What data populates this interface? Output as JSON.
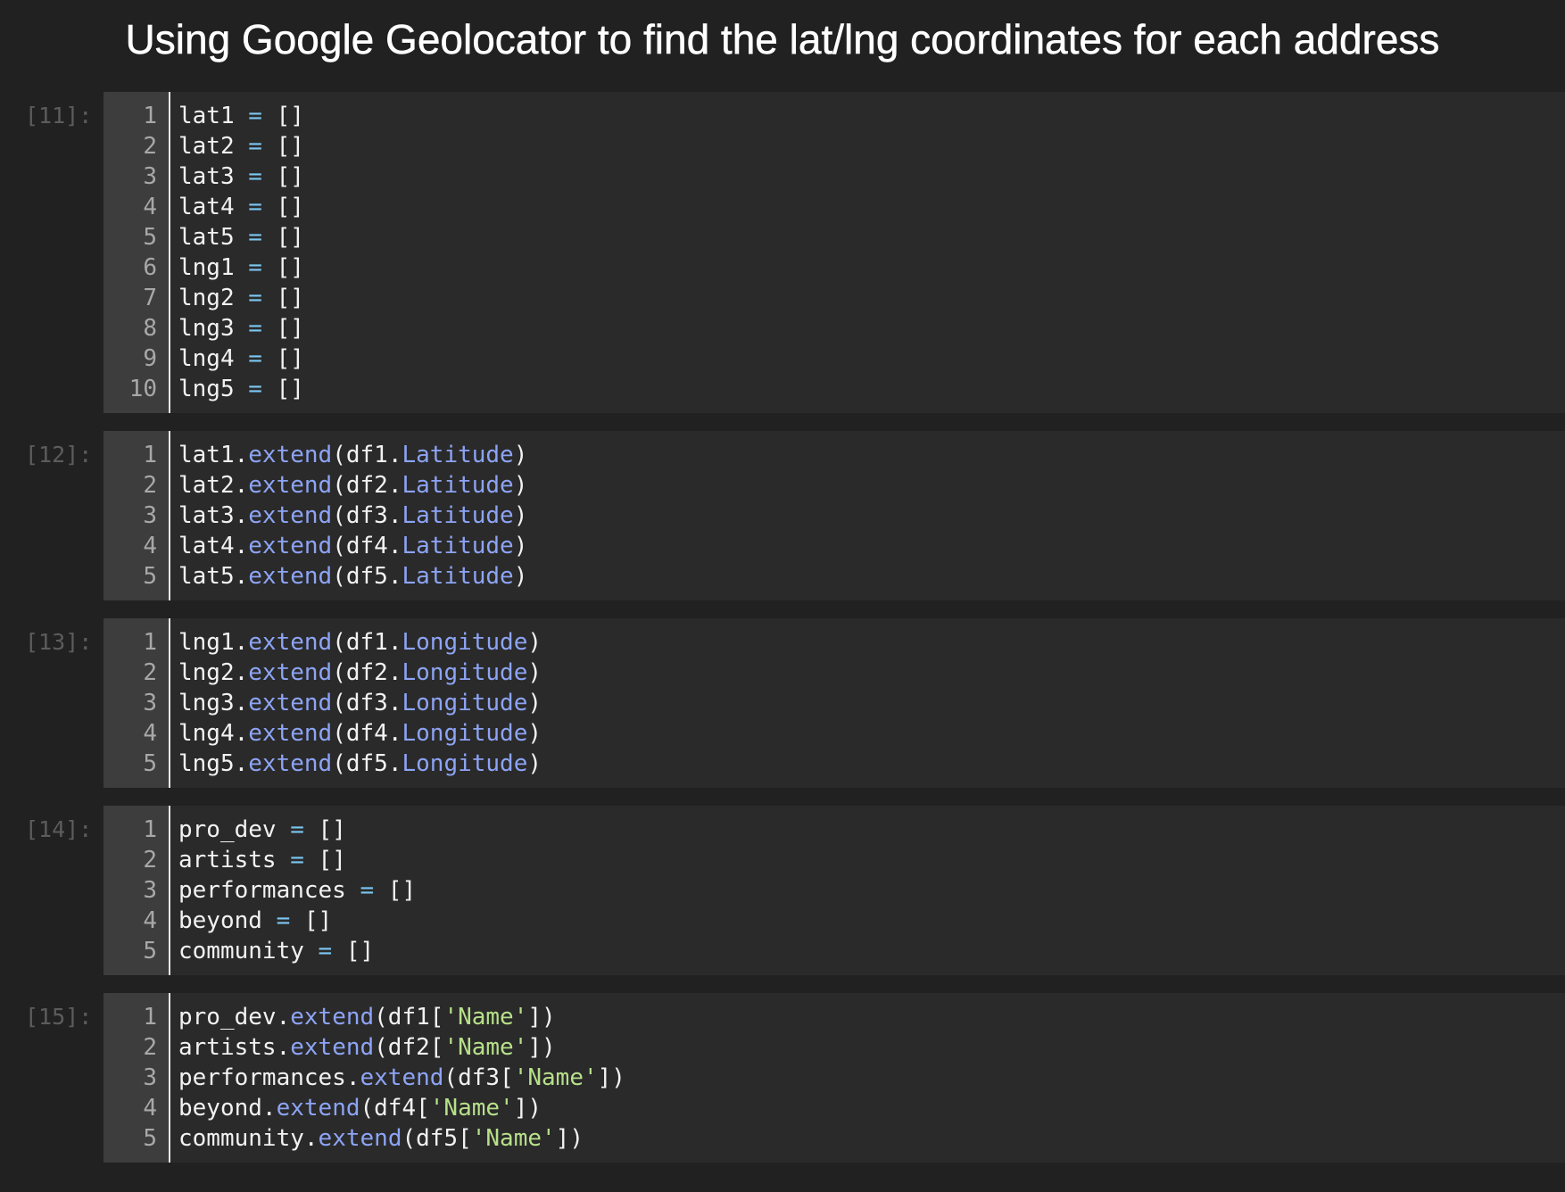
{
  "heading": "Using Google Geolocator to find the lat/lng coordinates for each address",
  "colors": {
    "background": "#212121",
    "editor_background": "#2a2a2a",
    "gutter_background": "#3d3d3d",
    "operator": "#7cc7f2",
    "method": "#8da4f5",
    "string": "#b7e08a"
  },
  "cells": [
    {
      "prompt": "[11]:",
      "lines": [
        {
          "n": "1",
          "tokens": [
            {
              "t": "lat1 ",
              "c": ""
            },
            {
              "t": "=",
              "c": "op"
            },
            {
              "t": " []",
              "c": ""
            }
          ]
        },
        {
          "n": "2",
          "tokens": [
            {
              "t": "lat2 ",
              "c": ""
            },
            {
              "t": "=",
              "c": "op"
            },
            {
              "t": " []",
              "c": ""
            }
          ]
        },
        {
          "n": "3",
          "tokens": [
            {
              "t": "lat3 ",
              "c": ""
            },
            {
              "t": "=",
              "c": "op"
            },
            {
              "t": " []",
              "c": ""
            }
          ]
        },
        {
          "n": "4",
          "tokens": [
            {
              "t": "lat4 ",
              "c": ""
            },
            {
              "t": "=",
              "c": "op"
            },
            {
              "t": " []",
              "c": ""
            }
          ]
        },
        {
          "n": "5",
          "tokens": [
            {
              "t": "lat5 ",
              "c": ""
            },
            {
              "t": "=",
              "c": "op"
            },
            {
              "t": " []",
              "c": ""
            }
          ]
        },
        {
          "n": "6",
          "tokens": [
            {
              "t": "lng1 ",
              "c": ""
            },
            {
              "t": "=",
              "c": "op"
            },
            {
              "t": " []",
              "c": ""
            }
          ]
        },
        {
          "n": "7",
          "tokens": [
            {
              "t": "lng2 ",
              "c": ""
            },
            {
              "t": "=",
              "c": "op"
            },
            {
              "t": " []",
              "c": ""
            }
          ]
        },
        {
          "n": "8",
          "tokens": [
            {
              "t": "lng3 ",
              "c": ""
            },
            {
              "t": "=",
              "c": "op"
            },
            {
              "t": " []",
              "c": ""
            }
          ]
        },
        {
          "n": "9",
          "tokens": [
            {
              "t": "lng4 ",
              "c": ""
            },
            {
              "t": "=",
              "c": "op"
            },
            {
              "t": " []",
              "c": ""
            }
          ]
        },
        {
          "n": "10",
          "tokens": [
            {
              "t": "lng5 ",
              "c": ""
            },
            {
              "t": "=",
              "c": "op"
            },
            {
              "t": " []",
              "c": ""
            }
          ]
        }
      ]
    },
    {
      "prompt": "[12]:",
      "lines": [
        {
          "n": "1",
          "tokens": [
            {
              "t": "lat1.",
              "c": ""
            },
            {
              "t": "extend",
              "c": "fn"
            },
            {
              "t": "(df1.",
              "c": ""
            },
            {
              "t": "Latitude",
              "c": "fn"
            },
            {
              "t": ")",
              "c": ""
            }
          ]
        },
        {
          "n": "2",
          "tokens": [
            {
              "t": "lat2.",
              "c": ""
            },
            {
              "t": "extend",
              "c": "fn"
            },
            {
              "t": "(df2.",
              "c": ""
            },
            {
              "t": "Latitude",
              "c": "fn"
            },
            {
              "t": ")",
              "c": ""
            }
          ]
        },
        {
          "n": "3",
          "tokens": [
            {
              "t": "lat3.",
              "c": ""
            },
            {
              "t": "extend",
              "c": "fn"
            },
            {
              "t": "(df3.",
              "c": ""
            },
            {
              "t": "Latitude",
              "c": "fn"
            },
            {
              "t": ")",
              "c": ""
            }
          ]
        },
        {
          "n": "4",
          "tokens": [
            {
              "t": "lat4.",
              "c": ""
            },
            {
              "t": "extend",
              "c": "fn"
            },
            {
              "t": "(df4.",
              "c": ""
            },
            {
              "t": "Latitude",
              "c": "fn"
            },
            {
              "t": ")",
              "c": ""
            }
          ]
        },
        {
          "n": "5",
          "tokens": [
            {
              "t": "lat5.",
              "c": ""
            },
            {
              "t": "extend",
              "c": "fn"
            },
            {
              "t": "(df5.",
              "c": ""
            },
            {
              "t": "Latitude",
              "c": "fn"
            },
            {
              "t": ")",
              "c": ""
            }
          ]
        }
      ]
    },
    {
      "prompt": "[13]:",
      "lines": [
        {
          "n": "1",
          "tokens": [
            {
              "t": "lng1.",
              "c": ""
            },
            {
              "t": "extend",
              "c": "fn"
            },
            {
              "t": "(df1.",
              "c": ""
            },
            {
              "t": "Longitude",
              "c": "fn"
            },
            {
              "t": ")",
              "c": ""
            }
          ]
        },
        {
          "n": "2",
          "tokens": [
            {
              "t": "lng2.",
              "c": ""
            },
            {
              "t": "extend",
              "c": "fn"
            },
            {
              "t": "(df2.",
              "c": ""
            },
            {
              "t": "Longitude",
              "c": "fn"
            },
            {
              "t": ")",
              "c": ""
            }
          ]
        },
        {
          "n": "3",
          "tokens": [
            {
              "t": "lng3.",
              "c": ""
            },
            {
              "t": "extend",
              "c": "fn"
            },
            {
              "t": "(df3.",
              "c": ""
            },
            {
              "t": "Longitude",
              "c": "fn"
            },
            {
              "t": ")",
              "c": ""
            }
          ]
        },
        {
          "n": "4",
          "tokens": [
            {
              "t": "lng4.",
              "c": ""
            },
            {
              "t": "extend",
              "c": "fn"
            },
            {
              "t": "(df4.",
              "c": ""
            },
            {
              "t": "Longitude",
              "c": "fn"
            },
            {
              "t": ")",
              "c": ""
            }
          ]
        },
        {
          "n": "5",
          "tokens": [
            {
              "t": "lng5.",
              "c": ""
            },
            {
              "t": "extend",
              "c": "fn"
            },
            {
              "t": "(df5.",
              "c": ""
            },
            {
              "t": "Longitude",
              "c": "fn"
            },
            {
              "t": ")",
              "c": ""
            }
          ]
        }
      ]
    },
    {
      "prompt": "[14]:",
      "lines": [
        {
          "n": "1",
          "tokens": [
            {
              "t": "pro_dev ",
              "c": ""
            },
            {
              "t": "=",
              "c": "op"
            },
            {
              "t": " []",
              "c": ""
            }
          ]
        },
        {
          "n": "2",
          "tokens": [
            {
              "t": "artists ",
              "c": ""
            },
            {
              "t": "=",
              "c": "op"
            },
            {
              "t": " []",
              "c": ""
            }
          ]
        },
        {
          "n": "3",
          "tokens": [
            {
              "t": "performances ",
              "c": ""
            },
            {
              "t": "=",
              "c": "op"
            },
            {
              "t": " []",
              "c": ""
            }
          ]
        },
        {
          "n": "4",
          "tokens": [
            {
              "t": "beyond ",
              "c": ""
            },
            {
              "t": "=",
              "c": "op"
            },
            {
              "t": " []",
              "c": ""
            }
          ]
        },
        {
          "n": "5",
          "tokens": [
            {
              "t": "community ",
              "c": ""
            },
            {
              "t": "=",
              "c": "op"
            },
            {
              "t": " []",
              "c": ""
            }
          ]
        }
      ]
    },
    {
      "prompt": "[15]:",
      "lines": [
        {
          "n": "1",
          "tokens": [
            {
              "t": "pro_dev.",
              "c": ""
            },
            {
              "t": "extend",
              "c": "fn"
            },
            {
              "t": "(df1[",
              "c": ""
            },
            {
              "t": "'Name'",
              "c": "str"
            },
            {
              "t": "])",
              "c": ""
            }
          ]
        },
        {
          "n": "2",
          "tokens": [
            {
              "t": "artists.",
              "c": ""
            },
            {
              "t": "extend",
              "c": "fn"
            },
            {
              "t": "(df2[",
              "c": ""
            },
            {
              "t": "'Name'",
              "c": "str"
            },
            {
              "t": "])",
              "c": ""
            }
          ]
        },
        {
          "n": "3",
          "tokens": [
            {
              "t": "performances.",
              "c": ""
            },
            {
              "t": "extend",
              "c": "fn"
            },
            {
              "t": "(df3[",
              "c": ""
            },
            {
              "t": "'Name'",
              "c": "str"
            },
            {
              "t": "])",
              "c": ""
            }
          ]
        },
        {
          "n": "4",
          "tokens": [
            {
              "t": "beyond.",
              "c": ""
            },
            {
              "t": "extend",
              "c": "fn"
            },
            {
              "t": "(df4[",
              "c": ""
            },
            {
              "t": "'Name'",
              "c": "str"
            },
            {
              "t": "])",
              "c": ""
            }
          ]
        },
        {
          "n": "5",
          "tokens": [
            {
              "t": "community.",
              "c": ""
            },
            {
              "t": "extend",
              "c": "fn"
            },
            {
              "t": "(df5[",
              "c": ""
            },
            {
              "t": "'Name'",
              "c": "str"
            },
            {
              "t": "])",
              "c": ""
            }
          ]
        }
      ]
    }
  ]
}
